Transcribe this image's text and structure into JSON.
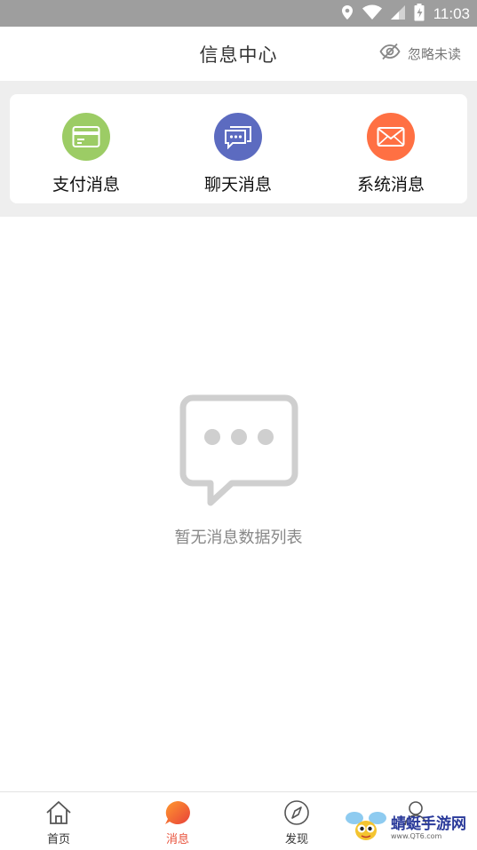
{
  "status": {
    "time": "11:03",
    "icons": [
      "location-icon",
      "wifi-icon",
      "signal-icon",
      "battery-icon"
    ]
  },
  "header": {
    "title": "信息中心",
    "ignore_label": "忽略未读",
    "ignore_icon": "eye-off-icon"
  },
  "categories": [
    {
      "label": "支付消息",
      "icon": "card-icon",
      "color": "#9ccc65"
    },
    {
      "label": "聊天消息",
      "icon": "chat-icon",
      "color": "#5c6bc0"
    },
    {
      "label": "系统消息",
      "icon": "envelope-icon",
      "color": "#ff7043"
    }
  ],
  "empty_state": {
    "text": "暂无消息数据列表",
    "icon": "empty-chat-icon",
    "icon_color": "#cfcfcf"
  },
  "tabs": [
    {
      "label": "首页",
      "icon": "home-icon",
      "active": false
    },
    {
      "label": "消息",
      "icon": "message-blob-icon",
      "active": true
    },
    {
      "label": "发现",
      "icon": "compass-icon",
      "active": false
    },
    {
      "label": "",
      "icon": "user-icon",
      "active": false
    }
  ],
  "watermark": {
    "name": "蜻蜓手游网",
    "url": "www.QT6.com"
  },
  "colors": {
    "accent": "#e8513a",
    "statusbar": "#9e9e9e",
    "band": "#eeeeee"
  }
}
